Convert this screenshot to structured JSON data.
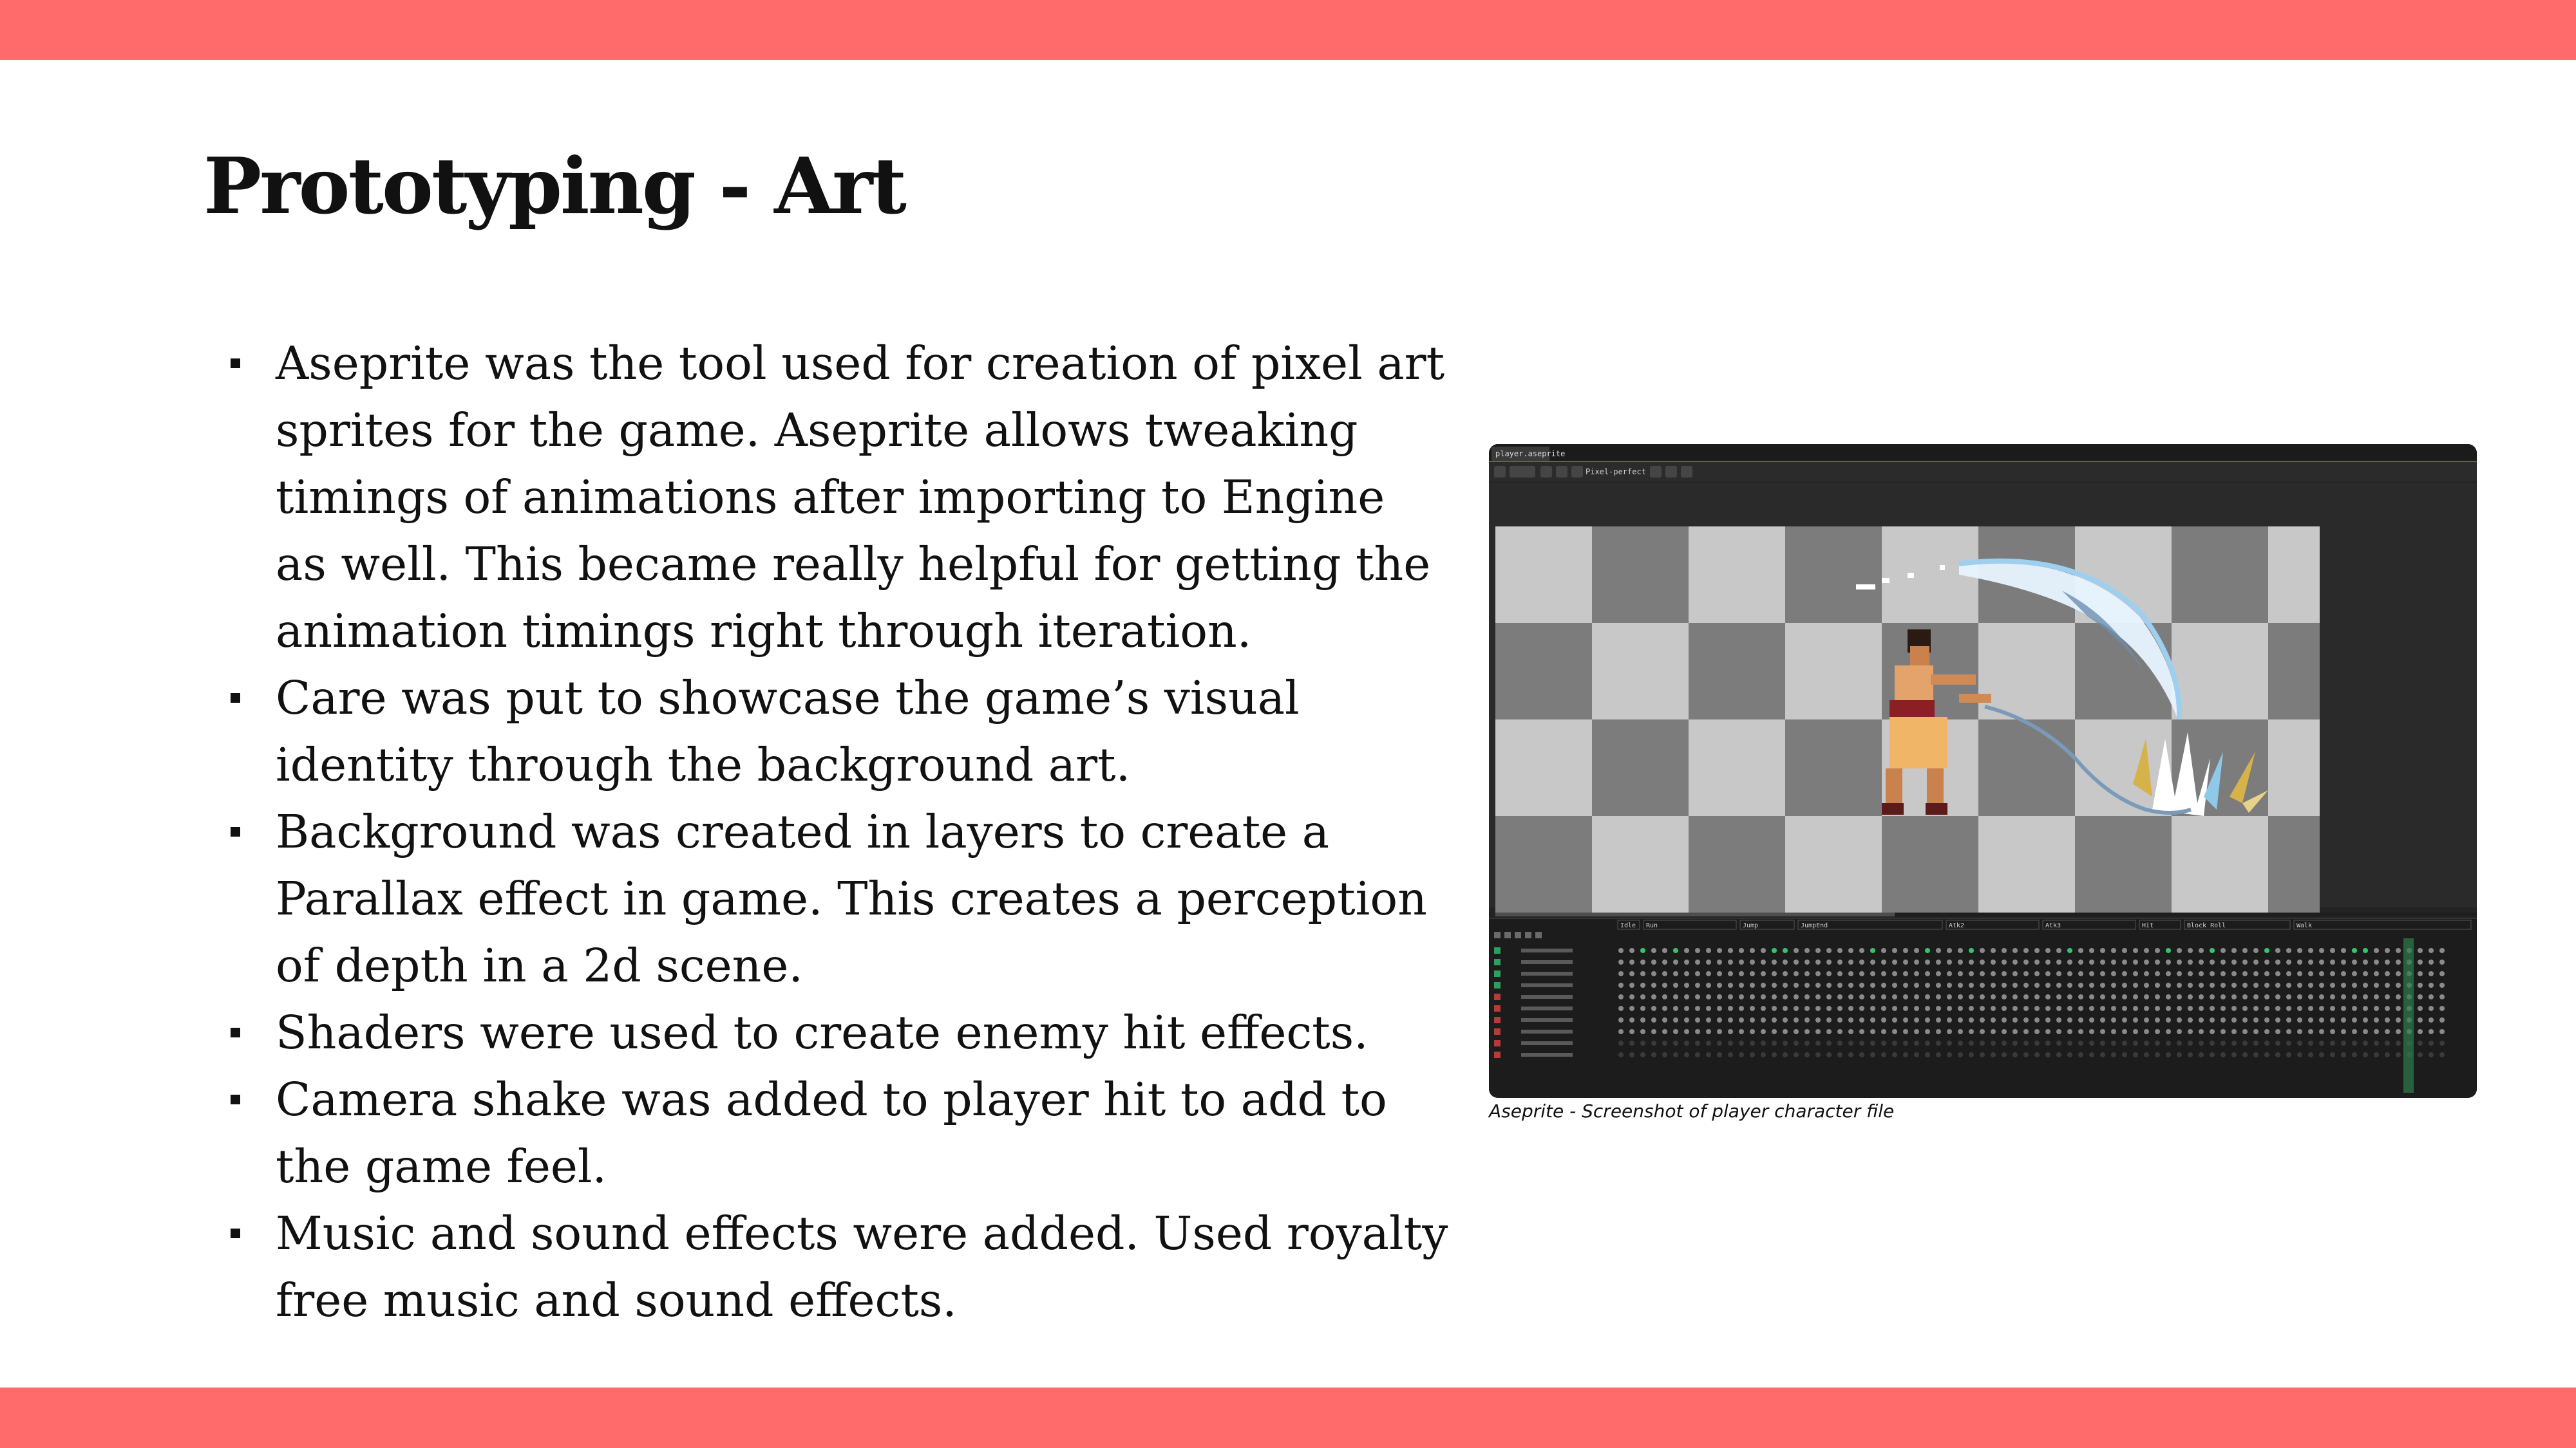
{
  "colors": {
    "band": "#ff6b6b",
    "text": "#111111",
    "background": "#ffffff"
  },
  "title": "Prototyping - Art",
  "bullets": [
    "Aseprite was the tool used for creation of pixel art sprites for the game. Aseprite allows tweaking timings of animations after importing to Engine as well. This became really helpful for getting the animation timings right through iteration.",
    "Care was put to showcase the game’s visual identity through the background art.",
    "Background was created in layers to create a Parallax effect in game. This creates a perception of depth in a 2d scene.",
    "Shaders were used to create enemy hit effects.",
    "Camera shake was added to player hit to add to the game feel.",
    "Music and sound effects were added. Used royalty free music and sound effects."
  ],
  "figure": {
    "caption": "Aseprite - Screenshot of player character file",
    "app": {
      "tab_label": "player.aseprite",
      "toolbar_label": "Pixel-perfect",
      "tag_labels": [
        "Idle",
        "Run",
        "Jump",
        "JumpEnd",
        "Atk2",
        "Atk3",
        "Hit",
        "Block Roll",
        "Walk"
      ]
    }
  }
}
